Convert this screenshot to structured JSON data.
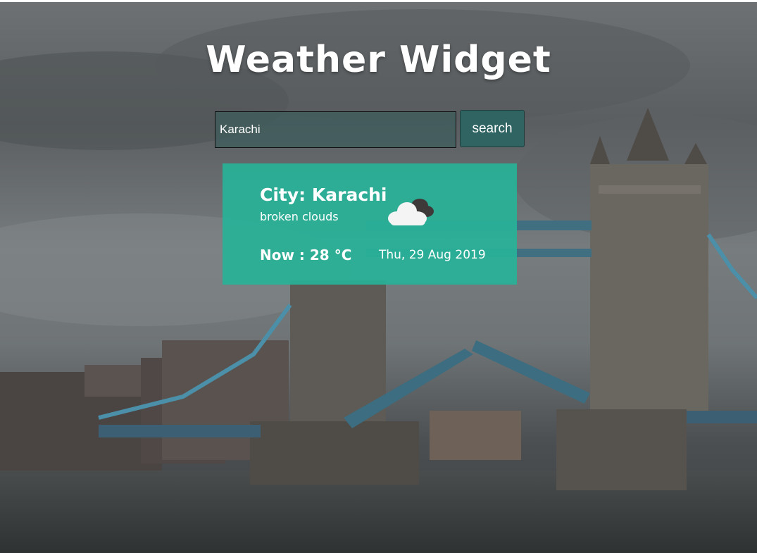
{
  "page": {
    "title": "Weather Widget"
  },
  "search": {
    "value": "Karachi",
    "button_label": "search"
  },
  "card": {
    "city_prefix": "City: ",
    "city": "Karachi",
    "description": "broken clouds",
    "now_prefix": "Now : ",
    "temperature": "28",
    "unit": " °C",
    "date": "Thu, 29 Aug 2019",
    "icon": "broken-clouds-icon"
  },
  "colors": {
    "card_background": "#29b198",
    "button_background": "#2f6462",
    "text": "#ffffff"
  }
}
